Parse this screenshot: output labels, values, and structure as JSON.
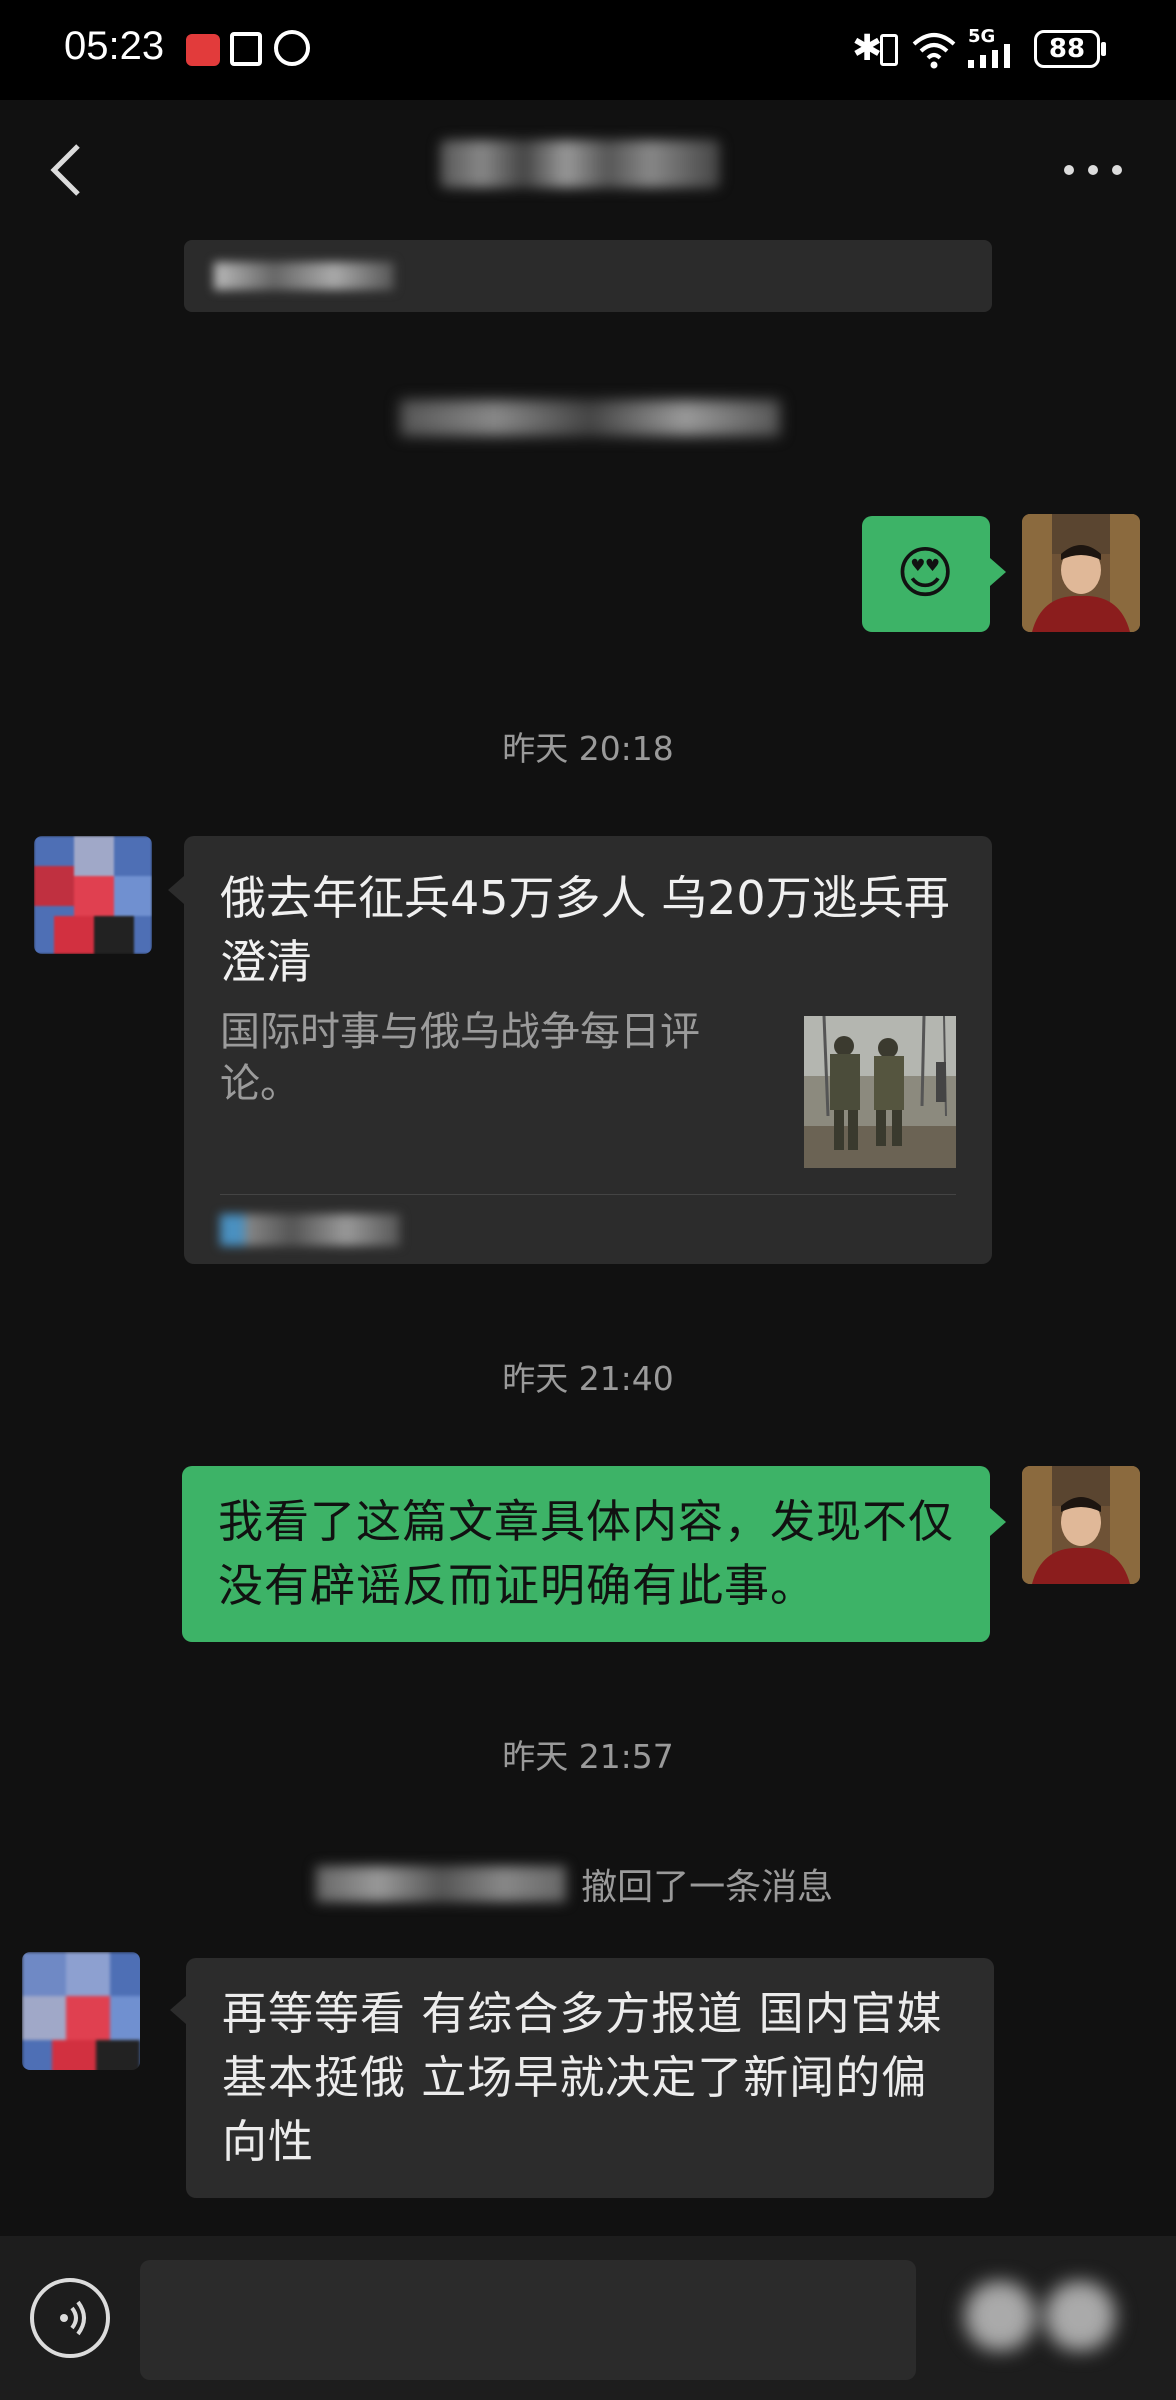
{
  "status_bar": {
    "time": "05:23",
    "battery": "88",
    "network": "5G"
  },
  "header": {
    "back_icon": "chevron-left-icon",
    "more_icon": "ellipsis-icon"
  },
  "messages": [
    {
      "type": "emoji",
      "side": "right",
      "emoji": "😍"
    },
    {
      "type": "time",
      "text": "昨天 20:18"
    },
    {
      "type": "link_card",
      "side": "left",
      "title": "俄去年征兵45万多人 乌20万逃兵再澄清",
      "description": "国际时事与俄乌战争每日评论。"
    },
    {
      "type": "time",
      "text": "昨天 21:40"
    },
    {
      "type": "text",
      "side": "right",
      "text": "我看了这篇文章具体内容，发现不仅没有辟谣反而证明确有此事。"
    },
    {
      "type": "time",
      "text": "昨天 21:57"
    },
    {
      "type": "system",
      "text": "撤回了一条消息"
    },
    {
      "type": "text",
      "side": "left",
      "text": "再等等看  有综合多方报道  国内官媒基本挺俄  立场早就决定了新闻的偏向性"
    }
  ],
  "colors": {
    "background": "#111111",
    "green_bubble": "#3db367",
    "dark_bubble": "#2c2c2c",
    "timestamp": "#9a9a9a"
  }
}
